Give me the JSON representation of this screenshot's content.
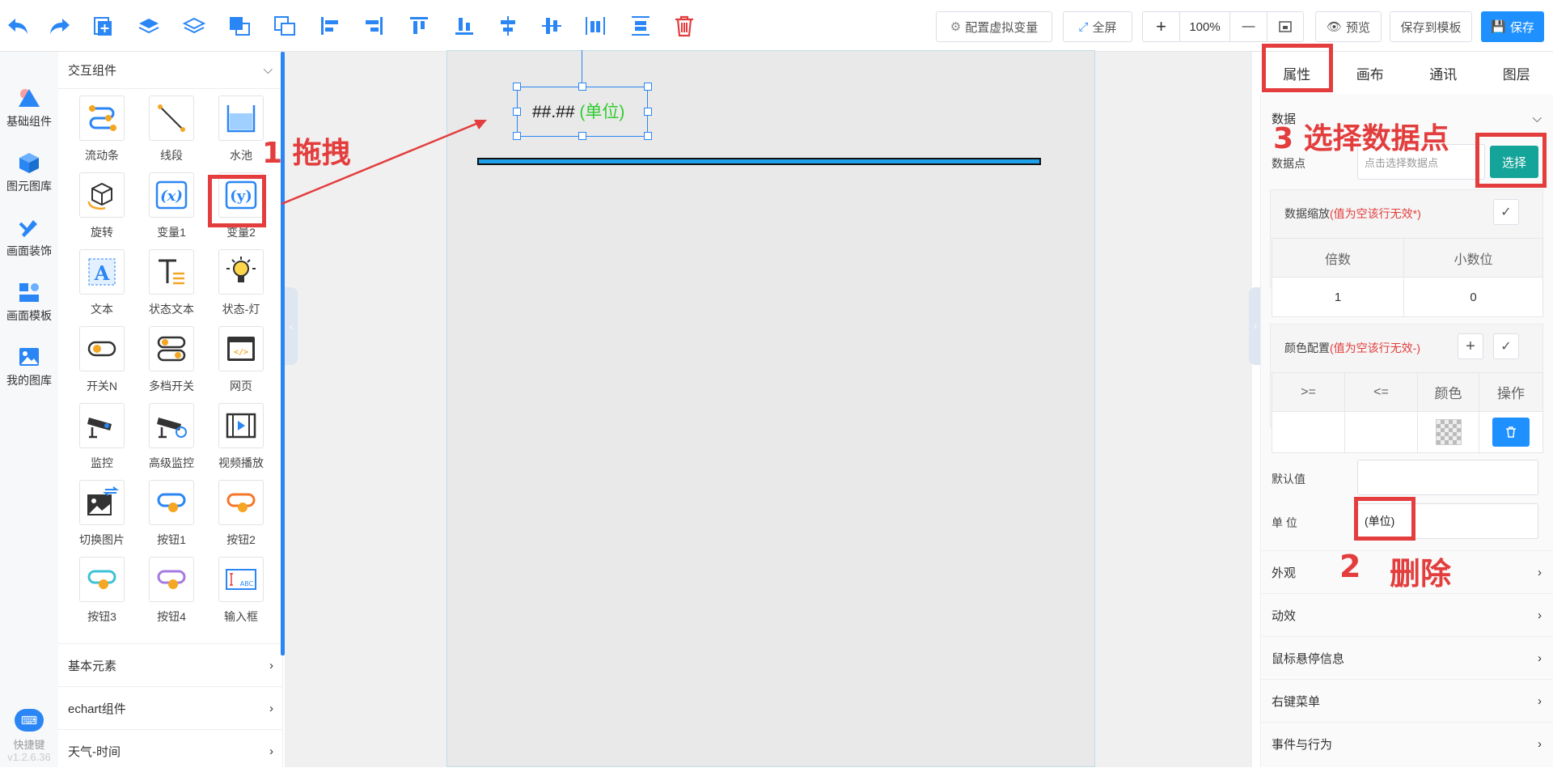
{
  "toolbar": {
    "icons": [
      "undo-icon",
      "redo-icon",
      "copy-icon",
      "bring-front-icon",
      "send-back-icon",
      "group-icon",
      "ungroup-icon",
      "align-left-icon",
      "align-right-icon",
      "align-top-icon",
      "align-bottom-icon",
      "align-center-h-icon",
      "align-center-v-icon",
      "distribute-h-icon",
      "distribute-v-icon",
      "delete-icon"
    ],
    "virtual_var": "配置虚拟变量",
    "fullscreen": "全屏",
    "zoom_in": "+",
    "zoom": "100%",
    "zoom_out": "—",
    "preview": "预览",
    "save_template": "保存到模板",
    "save": "保存"
  },
  "leftnav": {
    "items": [
      {
        "label": "基础组件",
        "icon": "triangle-shapes-icon"
      },
      {
        "label": "图元图库",
        "icon": "cube-icon"
      },
      {
        "label": "画面装饰",
        "icon": "brush-icon"
      },
      {
        "label": "画面模板",
        "icon": "template-icon"
      },
      {
        "label": "我的图库",
        "icon": "image-icon"
      }
    ],
    "shortcut": "快捷键",
    "version": "v1.2.6.36"
  },
  "palette": {
    "header": "交互组件",
    "components": [
      {
        "label": "流动条",
        "icon": "flow-bar-icon"
      },
      {
        "label": "线段",
        "icon": "line-segment-icon"
      },
      {
        "label": "水池",
        "icon": "water-tank-icon"
      },
      {
        "label": "旋转",
        "icon": "rotate-icon"
      },
      {
        "label": "变量1",
        "icon": "variable-x-icon"
      },
      {
        "label": "变量2",
        "icon": "variable-y-icon"
      },
      {
        "label": "文本",
        "icon": "text-icon"
      },
      {
        "label": "状态文本",
        "icon": "status-text-icon"
      },
      {
        "label": "状态-灯",
        "icon": "status-lamp-icon"
      },
      {
        "label": "开关N",
        "icon": "switch-icon"
      },
      {
        "label": "多档开关",
        "icon": "multi-switch-icon"
      },
      {
        "label": "网页",
        "icon": "webpage-icon"
      },
      {
        "label": "监控",
        "icon": "camera-icon"
      },
      {
        "label": "高级监控",
        "icon": "advanced-camera-icon"
      },
      {
        "label": "视频播放",
        "icon": "video-icon"
      },
      {
        "label": "切换图片",
        "icon": "switch-image-icon"
      },
      {
        "label": "按钮1",
        "icon": "button1-icon"
      },
      {
        "label": "按钮2",
        "icon": "button2-icon"
      },
      {
        "label": "按钮3",
        "icon": "button3-icon"
      },
      {
        "label": "按钮4",
        "icon": "button4-icon"
      },
      {
        "label": "输入框",
        "icon": "input-box-icon"
      }
    ],
    "sections": [
      "基本元素",
      "echart组件",
      "天气-时间"
    ]
  },
  "canvas": {
    "element_text": "##.##",
    "element_unit": "(单位)"
  },
  "rightpanel": {
    "tabs": [
      "属性",
      "画布",
      "通讯",
      "图层"
    ],
    "data_section": "数据",
    "datapoint_label": "数据点",
    "datapoint_placeholder": "点击选择数据点",
    "select_btn": "选择",
    "scale_label": "数据缩放",
    "scale_note": "(值为空该行无效*)",
    "scale_headers": [
      "倍数",
      "小数位"
    ],
    "scale_values": [
      "1",
      "0"
    ],
    "color_label": "颜色配置",
    "color_note": "(值为空该行无效-)",
    "color_headers": [
      ">=",
      "<=",
      "颜色",
      "操作"
    ],
    "default_label": "默认值",
    "default_value": "",
    "unit_label": "单 位",
    "unit_value": "(单位)",
    "accordions": [
      "外观",
      "动效",
      "鼠标悬停信息",
      "右键菜单",
      "事件与行为"
    ]
  },
  "annotations": {
    "a1": "1 拖拽",
    "a2_num": "2",
    "a2_text": "删除",
    "a3": "3 选择数据点"
  },
  "colors": {
    "accent": "#2a86f5",
    "annotation": "#e33d3d",
    "select_btn": "#15a49a",
    "unit_green": "#2ecc2e"
  }
}
